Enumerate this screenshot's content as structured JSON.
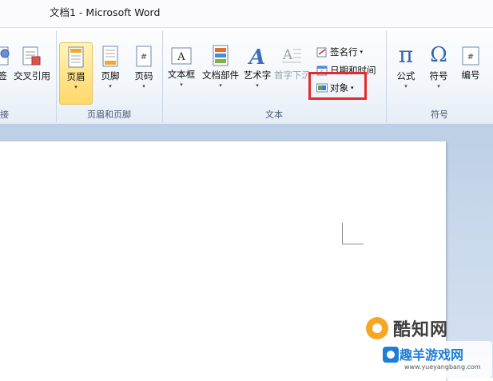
{
  "window": {
    "title": "文档1 - Microsoft Word"
  },
  "ribbon": {
    "links_group": {
      "label": "接",
      "buttons": [
        {
          "label": "签"
        },
        {
          "label": "交叉引用"
        }
      ]
    },
    "header_footer_group": {
      "label": "页眉和页脚",
      "buttons": [
        {
          "label": "页眉"
        },
        {
          "label": "页脚"
        },
        {
          "label": "页码"
        }
      ]
    },
    "text_group": {
      "label": "文本",
      "buttons": [
        {
          "label": "文本框"
        },
        {
          "label": "文档部件"
        },
        {
          "label": "艺术字"
        },
        {
          "label": "首字下沉"
        }
      ],
      "small_buttons": [
        {
          "label": "签名行"
        },
        {
          "label": "日期和时间"
        },
        {
          "label": "对象"
        }
      ]
    },
    "symbols_group": {
      "label": "符号",
      "buttons": [
        {
          "label": "公式"
        },
        {
          "label": "符号"
        },
        {
          "label": "编号"
        }
      ]
    },
    "dropdown_arrow": "▾",
    "colors": {
      "highlight": "#e52a2a",
      "active": "#ffe48a"
    }
  },
  "watermark": {
    "brand": "酷知网",
    "site": "趣羊游戏网",
    "url": "www.yueyangbang.com"
  }
}
